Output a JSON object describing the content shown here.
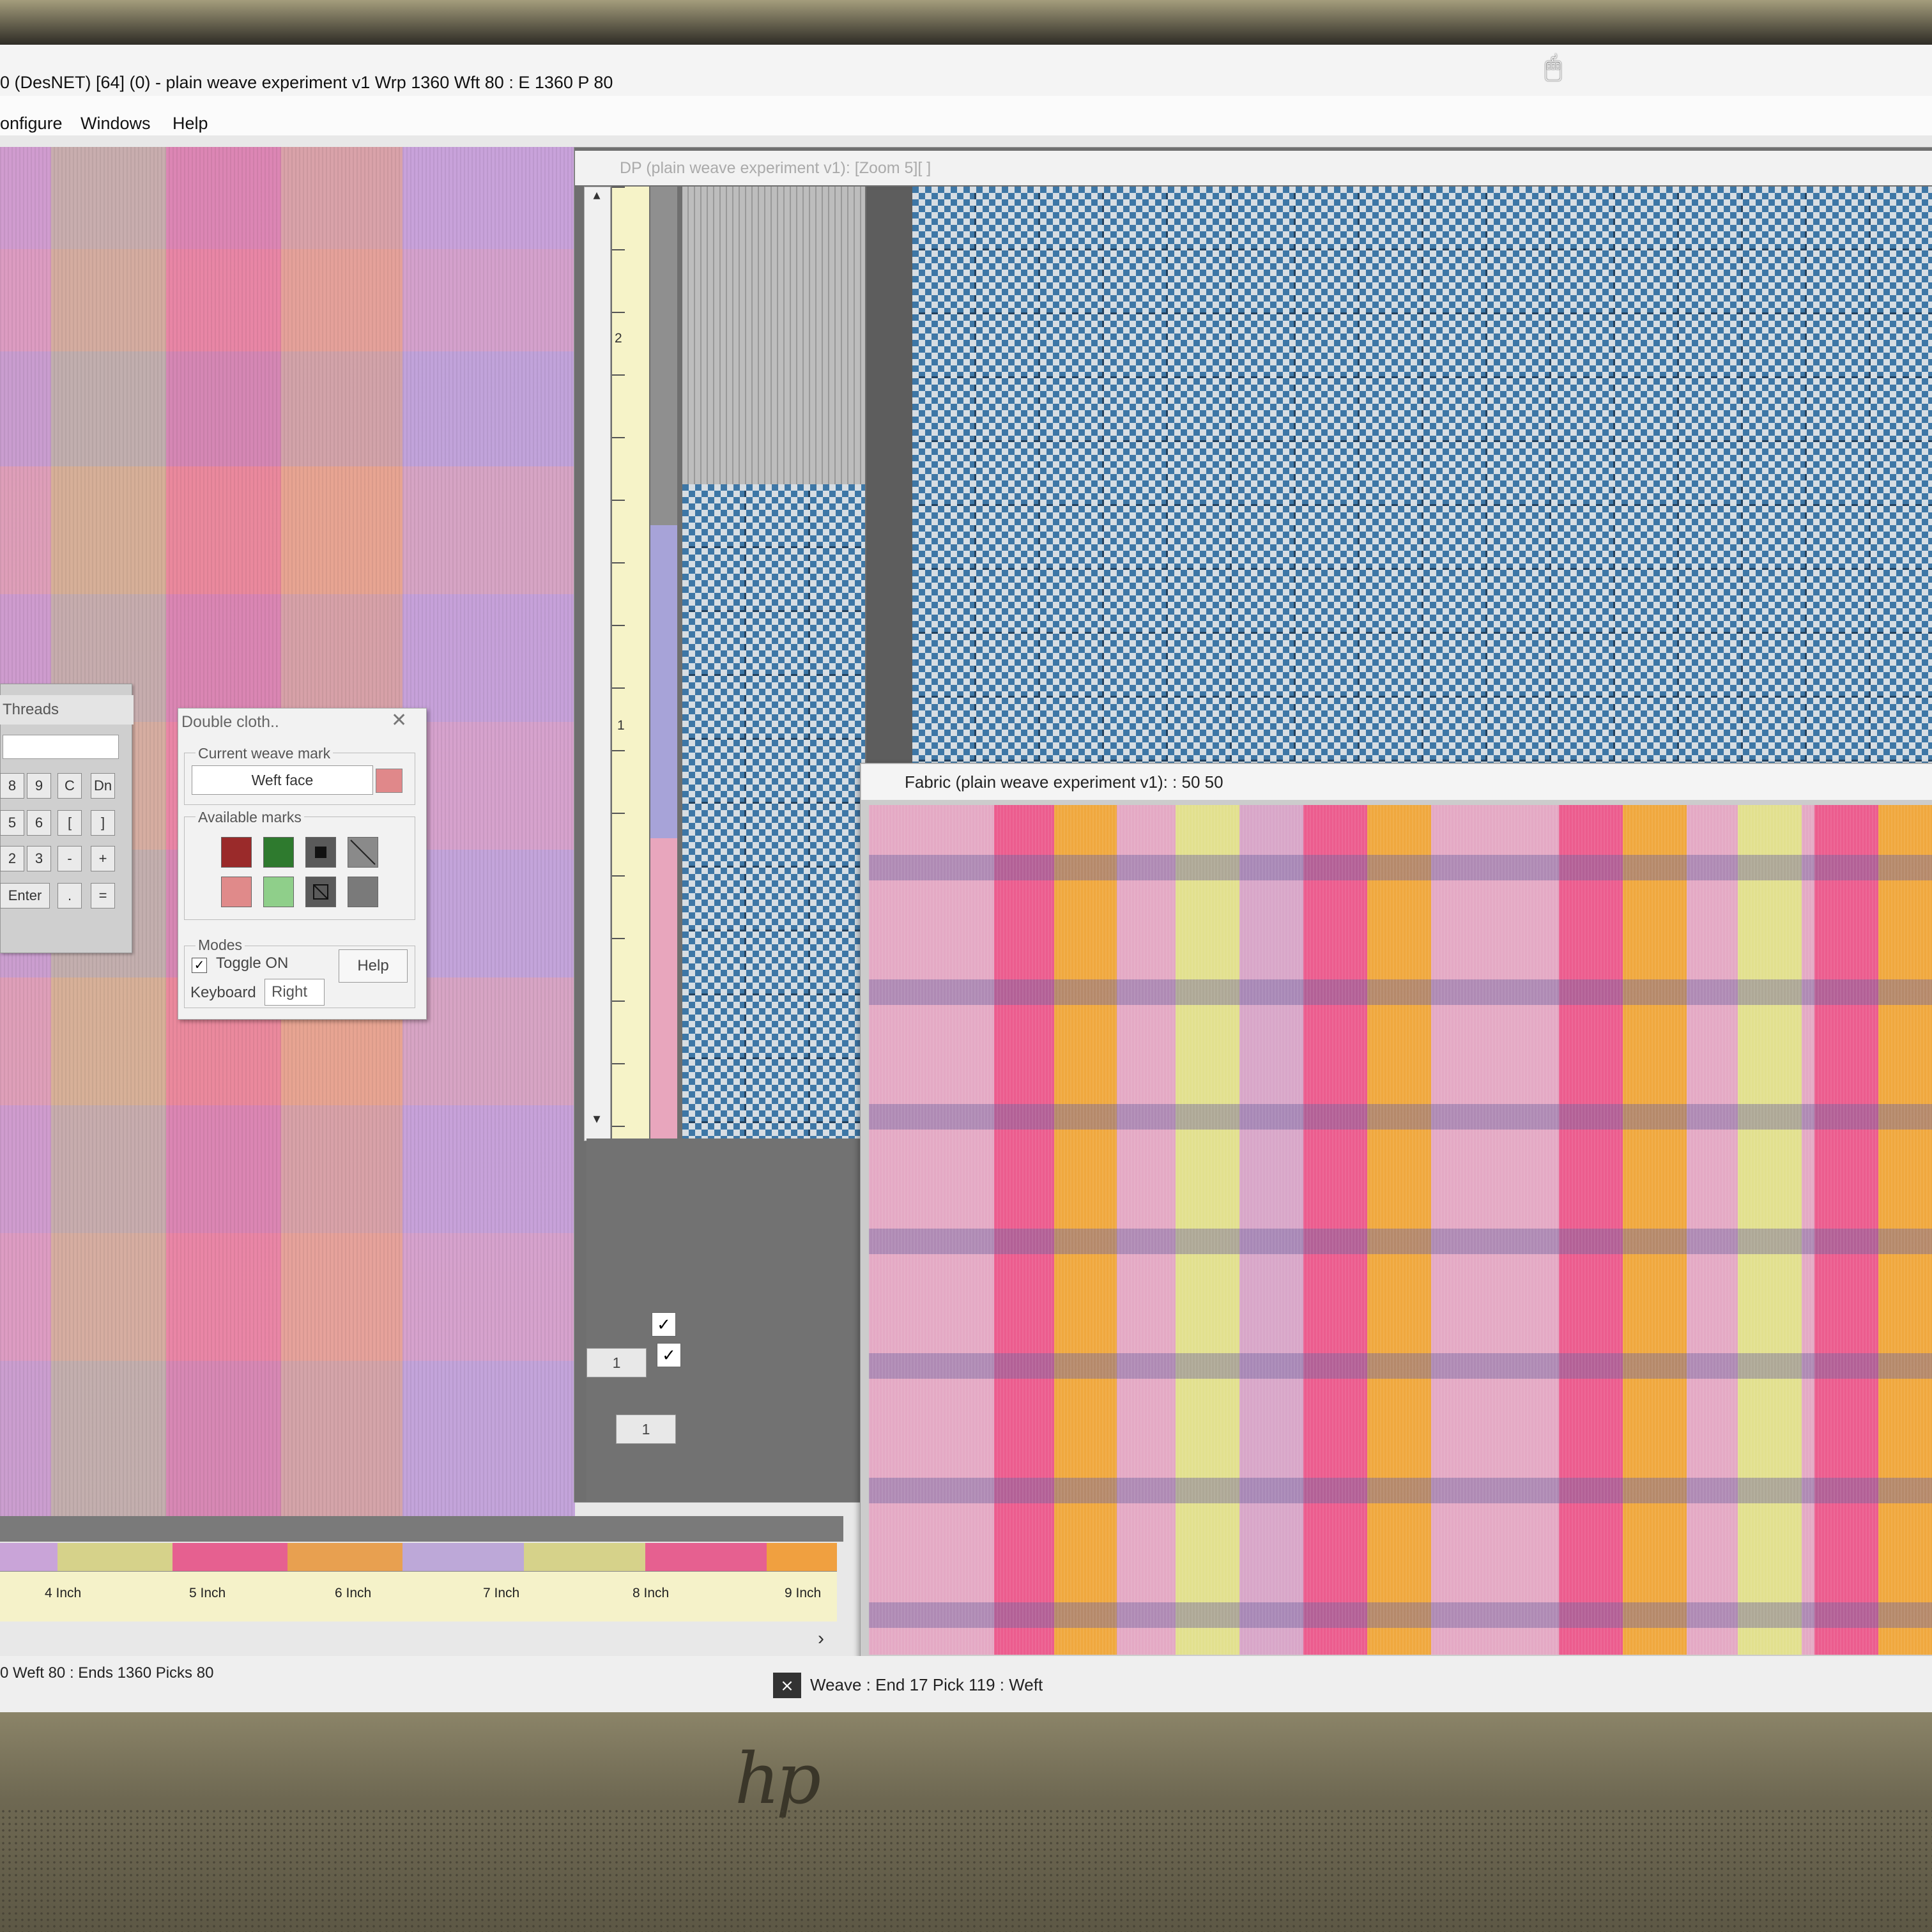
{
  "window": {
    "title": "0 (DesNET) [64] (0) - plain weave experiment v1 Wrp 1360 Wft 80 : E 1360 P 80"
  },
  "menu": {
    "items": [
      "onfigure",
      "Windows",
      "Help"
    ]
  },
  "threads_panel": {
    "title": "Threads",
    "keys": [
      "8",
      "9",
      "C",
      "Dn",
      "5",
      "6",
      "[",
      "]",
      "2",
      "3",
      "-",
      "+",
      "Enter",
      ".",
      "="
    ]
  },
  "double_cloth": {
    "title": "Double cloth..",
    "current_weave_mark_label": "Current weave mark",
    "current_weave_mark_value": "Weft face",
    "current_swatch_color": "#e0888a",
    "available_marks_label": "Available marks",
    "marks": [
      {
        "color": "#9a2a2a"
      },
      {
        "color": "#2e7a2e"
      },
      {
        "color": "#4a4a4a",
        "icon": "filled-square-icon"
      },
      {
        "color": "#8a8a8a",
        "icon": "diagonal-slash-icon"
      },
      {
        "color": "#e08a8a"
      },
      {
        "color": "#8fcf8a"
      },
      {
        "color": "#5a5a5a",
        "icon": "crossed-square-icon"
      },
      {
        "color": "#7a7a7a"
      }
    ],
    "modes_label": "Modes",
    "toggle_label": "Toggle ON",
    "toggle_checked": true,
    "help_label": "Help",
    "keyboard_label": "Keyboard",
    "keyboard_value": "Right"
  },
  "dp_window": {
    "title": "DP (plain weave experiment v1): [Zoom 5][ ]",
    "ruler_labels": [
      "2",
      "1"
    ],
    "lower_fields": [
      "1",
      "1"
    ]
  },
  "fabric_window": {
    "title": "Fabric (plain weave experiment v1): :   50   50"
  },
  "left_ruler": {
    "labels": [
      "4 Inch",
      "5 Inch",
      "6 Inch",
      "7 Inch",
      "8 Inch",
      "9 Inch"
    ]
  },
  "status": {
    "left": "0 Weft 80 : Ends 1360 Picks 80",
    "right": "Weave : End 17  Pick 119 : Weft"
  },
  "logo": "hp"
}
